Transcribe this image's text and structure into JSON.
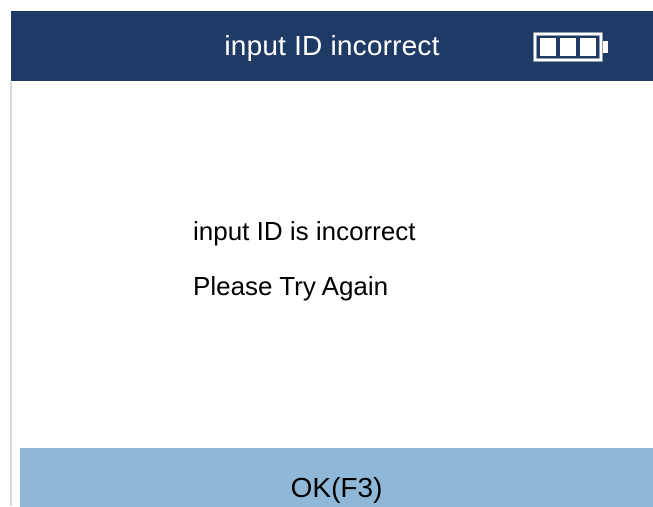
{
  "header": {
    "title": "input ID incorrect",
    "battery_icon": "battery-full-icon",
    "battery_level": 1.0
  },
  "message": {
    "line1": "input ID is incorrect",
    "line2": "Please Try Again"
  },
  "footer": {
    "ok_label": "OK(F3)"
  },
  "colors": {
    "header_bg": "#1f3a65",
    "footer_bg": "#8fb8d8",
    "text": "#000000",
    "header_text": "#ffffff"
  }
}
